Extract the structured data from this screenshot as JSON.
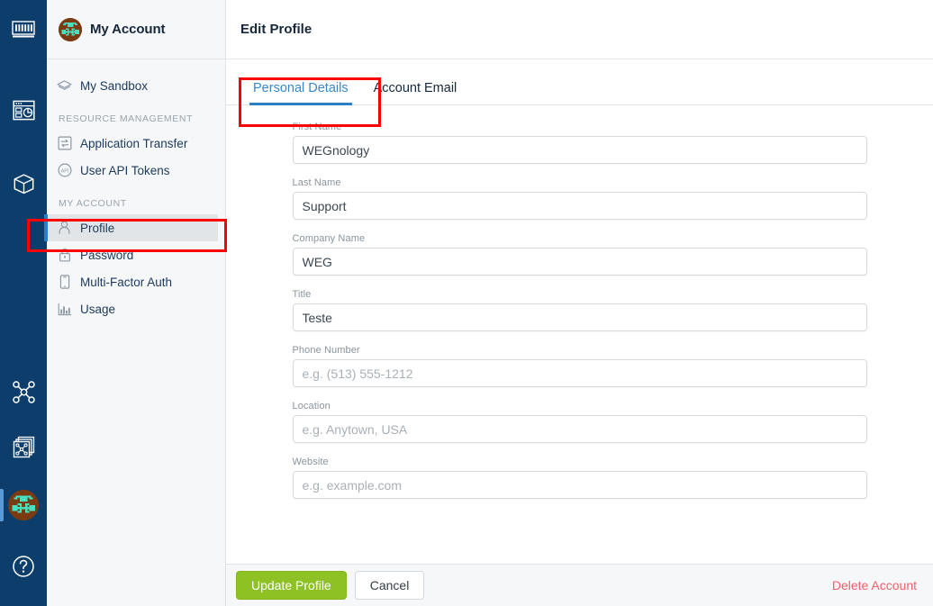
{
  "rail": {
    "items": [
      {
        "name": "weg-logo",
        "label": "WEG"
      },
      {
        "name": "dashboard-icon",
        "label": "Dashboards"
      },
      {
        "name": "package-icon",
        "label": "Applications"
      },
      {
        "name": "workflow-icon",
        "label": "Workflows"
      },
      {
        "name": "workflow-stack-icon",
        "label": "Experience"
      },
      {
        "name": "account-avatar",
        "label": "My Account"
      },
      {
        "name": "help-icon",
        "label": "Help"
      }
    ]
  },
  "sidebar": {
    "title": "My Account",
    "sandbox_label": "My Sandbox",
    "sections": [
      {
        "heading": "RESOURCE MANAGEMENT",
        "items": [
          {
            "label": "Application Transfer",
            "icon": "transfer-icon"
          },
          {
            "label": "User API Tokens",
            "icon": "api-token-icon"
          }
        ]
      },
      {
        "heading": "MY ACCOUNT",
        "items": [
          {
            "label": "Profile",
            "icon": "person-icon",
            "active": true
          },
          {
            "label": "Password",
            "icon": "lock-icon"
          },
          {
            "label": "Multi-Factor Auth",
            "icon": "mobile-icon"
          },
          {
            "label": "Usage",
            "icon": "bar-chart-icon"
          }
        ]
      }
    ]
  },
  "main": {
    "title": "Edit Profile",
    "tabs": [
      {
        "label": "Personal Details",
        "active": true
      },
      {
        "label": "Account Email",
        "active": false
      }
    ],
    "fields": [
      {
        "label": "First Name",
        "value": "WEGnology",
        "placeholder": ""
      },
      {
        "label": "Last Name",
        "value": "Support",
        "placeholder": ""
      },
      {
        "label": "Company Name",
        "value": "WEG",
        "placeholder": ""
      },
      {
        "label": "Title",
        "value": "Teste",
        "placeholder": ""
      },
      {
        "label": "Phone Number",
        "value": "",
        "placeholder": "e.g. (513) 555-1212"
      },
      {
        "label": "Location",
        "value": "",
        "placeholder": "e.g. Anytown, USA"
      },
      {
        "label": "Website",
        "value": "",
        "placeholder": "e.g. example.com"
      }
    ],
    "footer": {
      "update_label": "Update Profile",
      "cancel_label": "Cancel",
      "delete_label": "Delete Account"
    }
  },
  "colors": {
    "rail_bg": "#0d3d6b",
    "sidebar_bg": "#f5f7f8",
    "accent_blue": "#2980c4",
    "primary_green": "#8dc124",
    "danger_red": "#f0616d",
    "annotation_red": "#ff0000",
    "avatar_body": "#7b3b12",
    "avatar_face": "#46e0c0"
  }
}
